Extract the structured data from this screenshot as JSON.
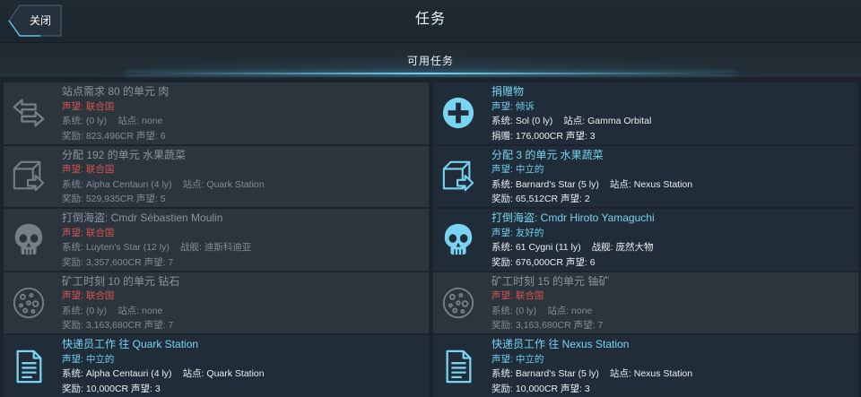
{
  "theme": {
    "page_bg": "#1b242c",
    "accent": "#79d3f2",
    "card_bg": "#202d38",
    "card_bg_dim": "#2b353e",
    "text": "#e9eef1",
    "text_dim": "#838c92",
    "icon_dim": "#767f86",
    "title_dim": "#8b949b"
  },
  "header": {
    "close_label": "关闭",
    "title": "任务"
  },
  "section": {
    "title": "可用任务"
  },
  "missions": [
    {
      "icon": "exchange-arrows-icon",
      "enabled": false,
      "title": "站点需求 80 的单元 肉",
      "rep_label": "声望:",
      "rep_value": "联合国",
      "rep_color": "#d9524e",
      "system_label": "系统:",
      "system_value": "(0 ly)",
      "target_label": "站点:",
      "target_value": "none",
      "reward_label": "奖励:",
      "reward_value": "823,496CR",
      "rep_reward_label": "声望:",
      "rep_reward_value": "6"
    },
    {
      "icon": "donation-plus-icon",
      "enabled": true,
      "title": "捐赠物",
      "rep_label": "声望:",
      "rep_value": "倾诉",
      "rep_color": "#6fcdee",
      "system_label": "系统:",
      "system_value": "Sol (0 ly)",
      "target_label": "站点:",
      "target_value": "Gamma Orbital",
      "reward_label": "捐赠:",
      "reward_value": "176,000CR",
      "rep_reward_label": "声望:",
      "rep_reward_value": "3"
    },
    {
      "icon": "cube-arrow-icon",
      "enabled": false,
      "title": "分配 192 的单元 水果蔬菜",
      "rep_label": "声望:",
      "rep_value": "联合国",
      "rep_color": "#d9524e",
      "system_label": "系统:",
      "system_value": "Alpha Centauri (4 ly)",
      "target_label": "站点:",
      "target_value": "Quark Station",
      "reward_label": "奖励:",
      "reward_value": "529,935CR",
      "rep_reward_label": "声望:",
      "rep_reward_value": "5"
    },
    {
      "icon": "cube-arrow-icon",
      "enabled": true,
      "title": "分配 3 的单元 水果蔬菜",
      "rep_label": "声望:",
      "rep_value": "中立的",
      "rep_color": "#6fcdee",
      "system_label": "系统:",
      "system_value": "Barnard's Star (5 ly)",
      "target_label": "站点:",
      "target_value": "Nexus Station",
      "reward_label": "奖励:",
      "reward_value": "65,512CR",
      "rep_reward_label": "声望:",
      "rep_reward_value": "2"
    },
    {
      "icon": "skull-icon",
      "enabled": false,
      "title": "打倒海盗: Cmdr Sébastien Moulin",
      "rep_label": "声望:",
      "rep_value": "联合国",
      "rep_color": "#d9524e",
      "system_label": "系统:",
      "system_value": "Luyten's Star (12 ly)",
      "target_label": "战舰:",
      "target_value": "迪斯科迪亚",
      "reward_label": "奖励:",
      "reward_value": "3,357,600CR",
      "rep_reward_label": "声望:",
      "rep_reward_value": "7"
    },
    {
      "icon": "skull-icon",
      "enabled": true,
      "title": "打倒海盗: Cmdr Hiroto Yamaguchi",
      "rep_label": "声望:",
      "rep_value": "友好的",
      "rep_color": "#6fcdee",
      "system_label": "系统:",
      "system_value": "61 Cygni (11 ly)",
      "target_label": "战舰:",
      "target_value": "庞然大物",
      "reward_label": "奖励:",
      "reward_value": "676,000CR",
      "rep_reward_label": "声望:",
      "rep_reward_value": "6"
    },
    {
      "icon": "asteroid-icon",
      "enabled": false,
      "title": "矿工时刻 10 的单元 钻石",
      "rep_label": "声望:",
      "rep_value": "联合国",
      "rep_color": "#d9524e",
      "system_label": "系统:",
      "system_value": "(0 ly)",
      "target_label": "站点:",
      "target_value": "none",
      "reward_label": "奖励:",
      "reward_value": "3,163,680CR",
      "rep_reward_label": "声望:",
      "rep_reward_value": "7"
    },
    {
      "icon": "asteroid-icon",
      "enabled": false,
      "title": "矿工时刻 15 的单元 铀矿",
      "rep_label": "声望:",
      "rep_value": "联合国",
      "rep_color": "#d9524e",
      "system_label": "系统:",
      "system_value": "(0 ly)",
      "target_label": "站点:",
      "target_value": "none",
      "reward_label": "奖励:",
      "reward_value": "3,163,680CR",
      "rep_reward_label": "声望:",
      "rep_reward_value": "7"
    },
    {
      "icon": "document-icon",
      "enabled": true,
      "title": "快递员工作 往 Quark Station",
      "rep_label": "声望:",
      "rep_value": "中立的",
      "rep_color": "#6fcdee",
      "system_label": "系统:",
      "system_value": "Alpha Centauri (4 ly)",
      "target_label": "站点:",
      "target_value": "Quark Station",
      "reward_label": "奖励:",
      "reward_value": "10,000CR",
      "rep_reward_label": "声望:",
      "rep_reward_value": "3"
    },
    {
      "icon": "document-icon",
      "enabled": true,
      "title": "快递员工作 往 Nexus Station",
      "rep_label": "声望:",
      "rep_value": "中立的",
      "rep_color": "#6fcdee",
      "system_label": "系统:",
      "system_value": "Barnard's Star (5 ly)",
      "target_label": "站点:",
      "target_value": "Nexus Station",
      "reward_label": "奖励:",
      "reward_value": "10,000CR",
      "rep_reward_label": "声望:",
      "rep_reward_value": "3"
    }
  ]
}
